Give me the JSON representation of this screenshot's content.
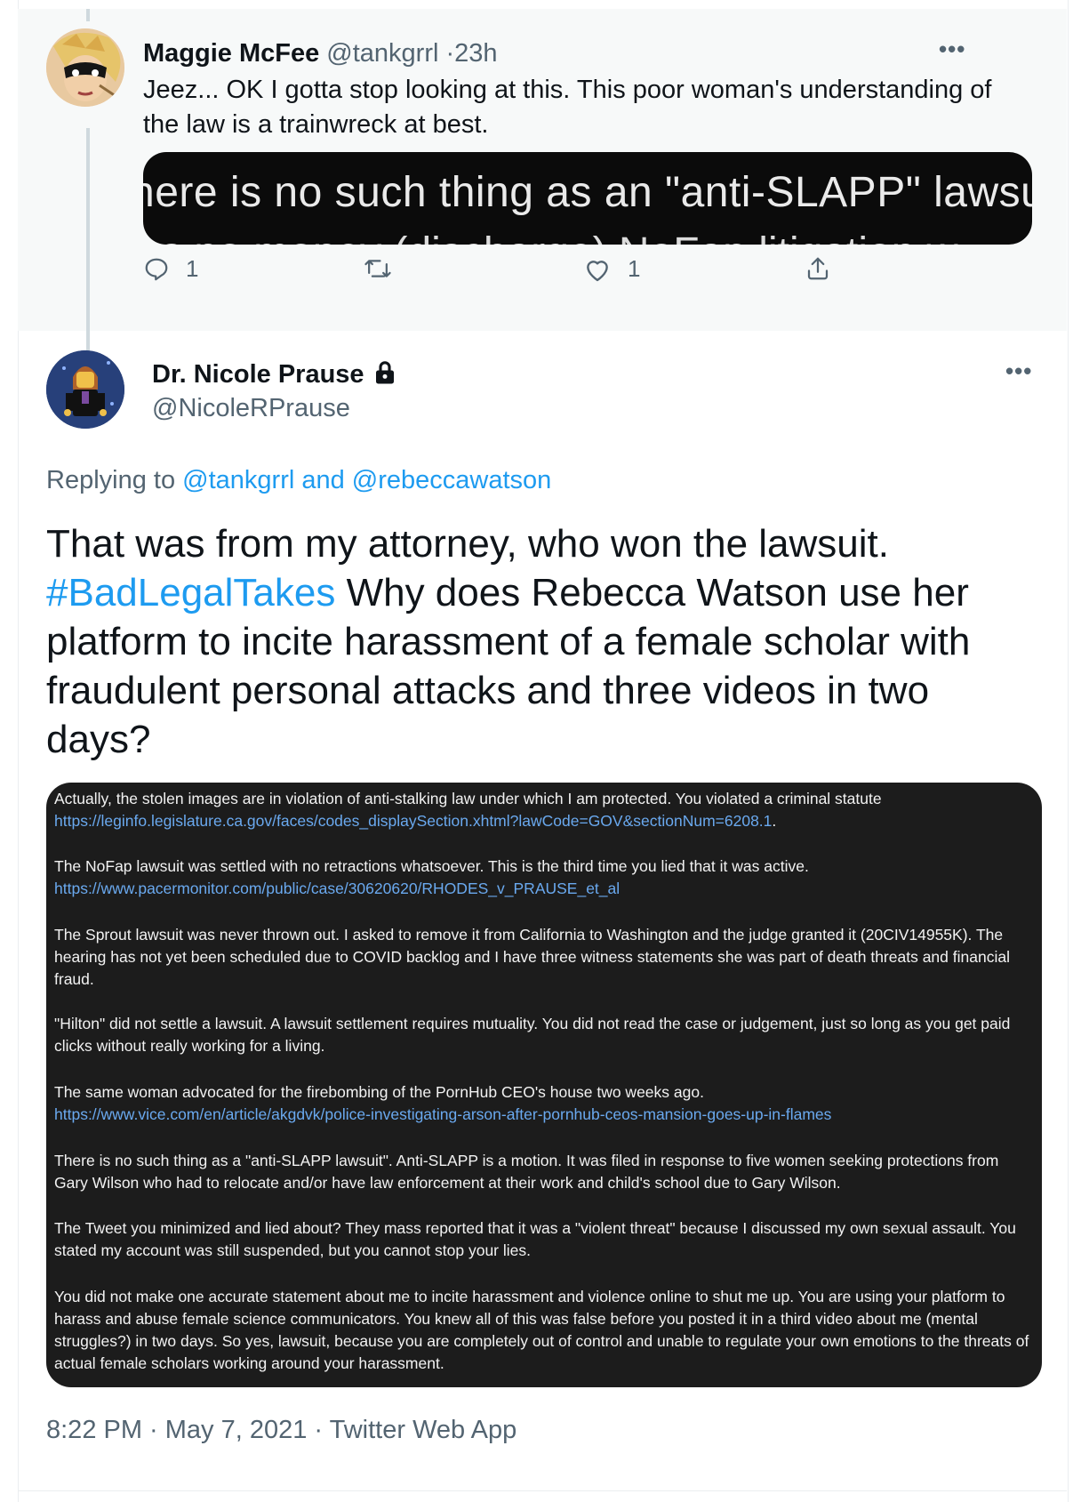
{
  "tweet1": {
    "name": "Maggie McFee",
    "handle": "@tankgrrl",
    "dot": "·",
    "time": "23h",
    "text": "Jeez... OK I gotta stop looking at this. This poor woman's understanding of the law is a trainwreck at best.",
    "image_text_line": "here is no such thing as an \"anti-SLAPP\" lawsu",
    "image_text_cut": "s no money (discharge) NoFap litigation w",
    "reply_count": "1",
    "like_count": "1"
  },
  "tweet2": {
    "name": "Dr. Nicole Prause",
    "handle": "@NicoleRPrause",
    "replying_prefix": "Replying to ",
    "replying_user1": "@tankgrrl",
    "replying_and": " and ",
    "replying_user2": "@rebeccawatson",
    "text_part1": "That was from my attorney, who won the lawsuit. ",
    "hashtag": "#BadLegalTakes",
    "text_part2": " Why does Rebecca Watson use her platform to incite harassment of a female scholar with fraudulent personal attacks and three videos in two days?",
    "timestamp": "8:22 PM · May 7, 2021 · Twitter Web App"
  },
  "screenshot": {
    "p1": "Actually, the stolen images are in violation of anti-stalking law under which I am protected. You violated a criminal statute",
    "p1_url": "https://leginfo.legislature.ca.gov/faces/codes_displaySection.xhtml?lawCode=GOV&sectionNum=6208.1",
    "p1_end": ".",
    "p2": "The NoFap lawsuit was settled with no retractions whatsoever. This is the third time you lied that it was active.",
    "p2_url": "https://www.pacermonitor.com/public/case/30620620/RHODES_v_PRAUSE_et_al",
    "p3": "The Sprout lawsuit was never thrown out. I asked to remove it from California to Washington and the judge granted it (20CIV14955K). The hearing has not yet been scheduled due to COVID backlog and I have three witness statements she was part of death threats and financial fraud.",
    "p4": "\"Hilton\" did not settle a lawsuit.  A lawsuit settlement requires mutuality. You did not read the case or judgement, just so long as you get paid clicks without really working for a living.",
    "p5": "The same woman advocated for the firebombing of the PornHub CEO's house two weeks ago.",
    "p5_url": "https://www.vice.com/en/article/akgdvk/police-investigating-arson-after-pornhub-ceos-mansion-goes-up-in-flames",
    "p6": "There is no such thing as a \"anti-SLAPP lawsuit\". Anti-SLAPP is a motion. It was filed in response to five women seeking protections from Gary Wilson who had to relocate and/or have law enforcement at their work and child's school due to Gary Wilson.",
    "p7": "The Tweet you minimized and lied about? They mass reported that it was a \"violent threat\" because I discussed my own sexual assault. You stated my account was still suspended, but you cannot stop your lies.",
    "p8": "You did not make one accurate statement about me to incite harassment and violence online to shut me up. You are using your platform to harass and abuse female science communicators. You knew all of this was false before you posted it in a third video about me (mental struggles?) in two days.  So yes, lawsuit, because you are completely out of control and unable to regulate your own emotions to the threats of actual female scholars working around your harassment."
  },
  "icons": {
    "more": "more-icon",
    "reply": "reply-icon",
    "retweet": "retweet-icon",
    "like": "like-icon",
    "share": "share-icon",
    "lock": "lock-icon"
  },
  "colors": {
    "link": "#1d9bf0",
    "muted": "#536471",
    "thread_line": "#cfd9de",
    "screenshot_bg": "#1c1c1c"
  }
}
